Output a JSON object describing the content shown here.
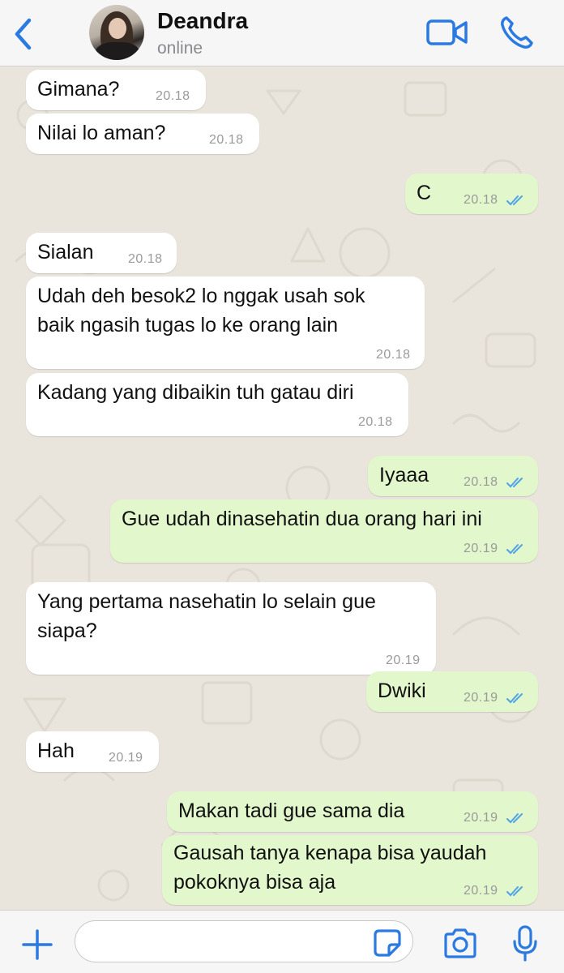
{
  "header": {
    "contact_name": "Deandra",
    "status": "online",
    "accent": "#2a7ae2"
  },
  "messages": [
    {
      "side": "in",
      "text": "Gimana?",
      "time": "20.18"
    },
    {
      "side": "in",
      "text": "Nilai lo aman?",
      "time": "20.18"
    },
    {
      "side": "out",
      "text": "C",
      "time": "20.18",
      "read": true
    },
    {
      "side": "in",
      "text": "Sialan",
      "time": "20.18"
    },
    {
      "side": "in",
      "text": "Udah deh besok2 lo nggak usah sok\nbaik ngasih tugas lo ke orang lain",
      "time": "20.18"
    },
    {
      "side": "in",
      "text": "Kadang yang dibaikin tuh gatau diri",
      "time": "20.18"
    },
    {
      "side": "out",
      "text": "Iyaaa",
      "time": "20.18",
      "read": true
    },
    {
      "side": "out",
      "text": "Gue udah dinasehatin dua orang hari ini",
      "time": "20.19",
      "read": true
    },
    {
      "side": "in",
      "text": "Yang pertama nasehatin lo selain gue\nsiapa?",
      "time": "20.19"
    },
    {
      "side": "out",
      "text": "Dwiki",
      "time": "20.19",
      "read": true
    },
    {
      "side": "in",
      "text": "Hah",
      "time": "20.19"
    },
    {
      "side": "out",
      "text": "Makan tadi gue sama dia",
      "time": "20.19",
      "read": true
    },
    {
      "side": "out",
      "text": "Gausah tanya kenapa bisa yaudah\npokoknya bisa aja",
      "time": "20.19",
      "read": true
    }
  ],
  "composer": {
    "value": ""
  },
  "colors": {
    "incoming_bubble": "#ffffff",
    "outgoing_bubble": "#e2f7cb",
    "read_ticks": "#4fa3e8",
    "wallpaper": "#e9e4dc"
  },
  "icons": {
    "back": "chevron-left-icon",
    "video": "video-camera-icon",
    "call": "phone-icon",
    "plus": "plus-icon",
    "sticker": "sticker-icon",
    "camera": "camera-icon",
    "mic": "microphone-icon"
  }
}
